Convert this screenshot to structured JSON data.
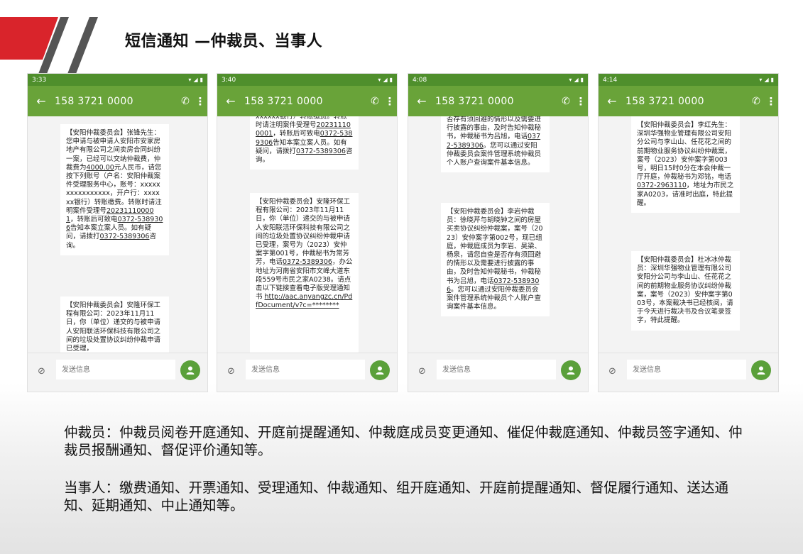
{
  "title": "短信通知 —仲裁员、当事人",
  "colors": {
    "statusbar": "#4f8f2c",
    "toolbar": "#69a339",
    "send": "#5aa03a",
    "logo_red": "#d9242b",
    "logo_gray": "#555555"
  },
  "input_placeholder": "发送信息",
  "phones": [
    {
      "time": "3:33",
      "contact": "158 3721 0000",
      "messages": [
        {
          "parts": [
            "【安阳仲裁委员会】张锋先生：您申请与被申请人安阳市安家房地产有限公司之间卖房合同纠纷一案，已经可以交纳仲裁费，仲裁费为",
            {
              "u": "4000.00"
            },
            "元人民币，请您按下列账号（户名：安阳仲裁案件受理服务中心，账号：xxxxxxxxxxxxxxxx，开户行：xxxxxx银行）转账缴费。转账时请注明案件受理号",
            {
              "u": "202311100001"
            },
            "，转账后可致电",
            {
              "u": "0372-5389306"
            },
            "告知本案立案人员。如有疑问，请拨打",
            {
              "u": "0372-5389306"
            },
            "咨询。"
          ]
        },
        {
          "parts": [
            "【安阳仲裁委员会】安隆环保工程有限公司：2023年11月11日，你（单位）递交的与被申请人安阳联活环保科技有限公司之间的垃圾处置协议纠纷仲裁申请已受理，"
          ]
        }
      ]
    },
    {
      "time": "3:40",
      "contact": "158 3721 0000",
      "messages": [
        {
          "parts": [
            "xxxxxx银行）转账缴费。转账时请注明案件受理号",
            {
              "u": "202311100001"
            },
            "，转账后可致电",
            {
              "u": "0372-5389306"
            },
            "告知本案立案人员。如有疑问，请拨打",
            {
              "u": "0372-5389306"
            },
            "咨询。"
          ]
        },
        {
          "parts": [
            "【安阳仲裁委员会】安隆环保工程有限公司：2023年11月11日，你（单位）递交的与被申请人安阳联活环保科技有限公司之间的垃圾处置协议纠纷仲裁申请已受理，案号为（2023）安仲案字第001号，仲裁秘书为常芳芳，电话",
            {
              "u": "0372-5389306"
            },
            "，办公地址为河南省安阳市文峰大道东段559号市民之家A0238。请点击以下链接查看电子版受理通知书 ",
            {
              "u": "http://aac.anyangzc.cn/PdfDocument/v?c=********"
            }
          ]
        }
      ]
    },
    {
      "time": "4:08",
      "contact": "158 3721 0000",
      "messages": [
        {
          "parts": [
            "否存有须回避的情形以及需要进行披露的事由，及时告知仲裁秘书，仲裁秘书为吕旭，电话",
            {
              "u": "0372-5389306"
            },
            "。您可以通过安阳仲裁委员会案件管理系统仲裁员个人账户查询案件基本信息。"
          ]
        },
        {
          "parts": [
            "【安阳仲裁委员会】李岩仲裁员：徐晓芹与胡晓钟之间的房屋买卖协议纠纷仲裁案，案号（2023）安仲案字第002号，现已组庭，仲裁庭成员为李岩、吴梁、杨泉，请您自查是否存有须回避的情形以及需要进行披露的事由，及时告知仲裁秘书，仲裁秘书为吕旭，电话",
            {
              "u": "0372-5389306"
            },
            "。您可以通过安阳仲裁委员会案件管理系统仲裁员个人账户查询案件基本信息。"
          ]
        }
      ]
    },
    {
      "time": "4:14",
      "contact": "158 3721 0000",
      "messages": [
        {
          "parts": [
            "【安阳仲裁委员会】李红先生：深圳华强物业管理有限公司安阳分公司与李山山、任花花之间的前期物业服务协议纠纷仲裁案，案号（2023）安仲案字第003号，明日15时0分在本会仲裁一厅开庭，仲裁秘书为邓铭，电话",
            {
              "u": "0372-2963110"
            },
            "，地址为市民之家A0203，请准时出庭，特此提醒。"
          ]
        },
        {
          "parts": [
            "【安阳仲裁委员会】杜冰冰仲裁员：深圳华强物业管理有限公司安阳分公司与李山山、任花花之间的前期物业服务协议纠纷仲裁案，案号（2023）安仲案字第003号，本案裁决书已经核阅，请于今天进行裁决书及合议笔录签字，特此提醒。"
          ]
        }
      ]
    }
  ],
  "captions": {
    "arbitrator": "仲裁员：仲裁员阅卷开庭通知、开庭前提醒通知、仲裁庭成员变更通知、催促仲裁庭通知、仲裁员签字通知、仲裁员报酬通知、督促评价通知等。",
    "party": "当事人：缴费通知、开票通知、受理通知、仲裁通知、组开庭通知、开庭前提醒通知、督促履行通知、送达通知、延期通知、中止通知等。"
  }
}
